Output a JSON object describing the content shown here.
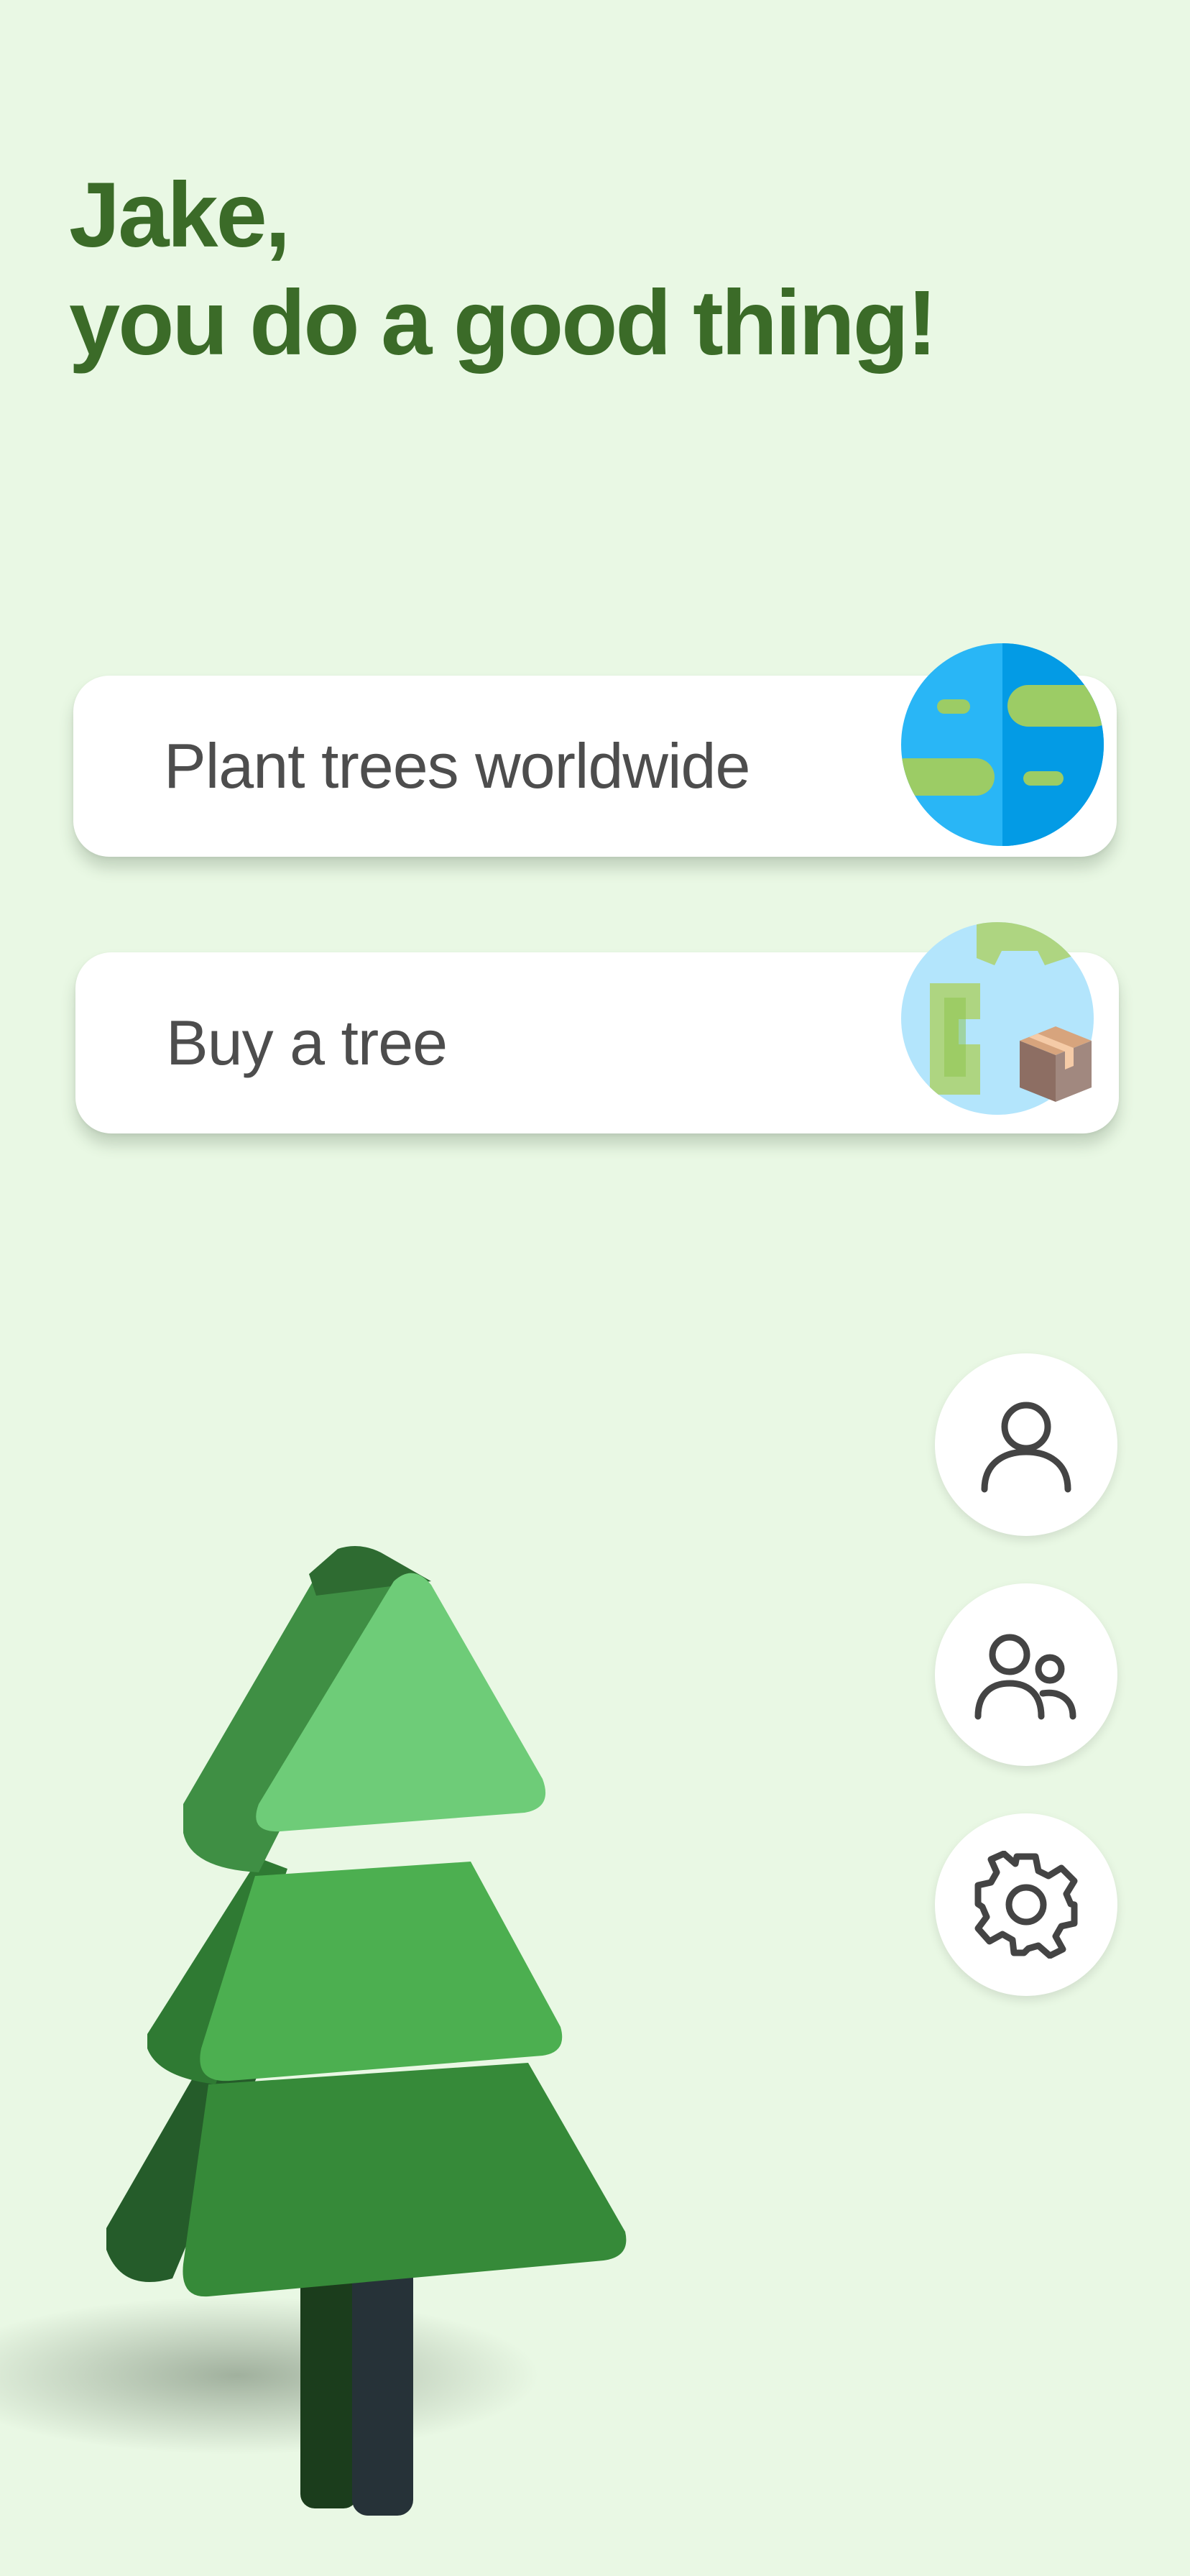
{
  "greeting": {
    "line1": "Jake,",
    "line2": "you do a good thing!"
  },
  "actions": [
    {
      "label": "Plant trees worldwide",
      "icon": "globe-icon"
    },
    {
      "label": "Buy a tree",
      "icon": "globe-package-icon"
    }
  ],
  "side_buttons": [
    {
      "icon": "profile-icon"
    },
    {
      "icon": "friends-icon"
    },
    {
      "icon": "settings-icon"
    }
  ],
  "illustration": "tree-illustration",
  "colors": {
    "background": "#e9f8e4",
    "heading": "#3b6b28",
    "card": "#ffffff",
    "label": "#4d4d4d"
  }
}
